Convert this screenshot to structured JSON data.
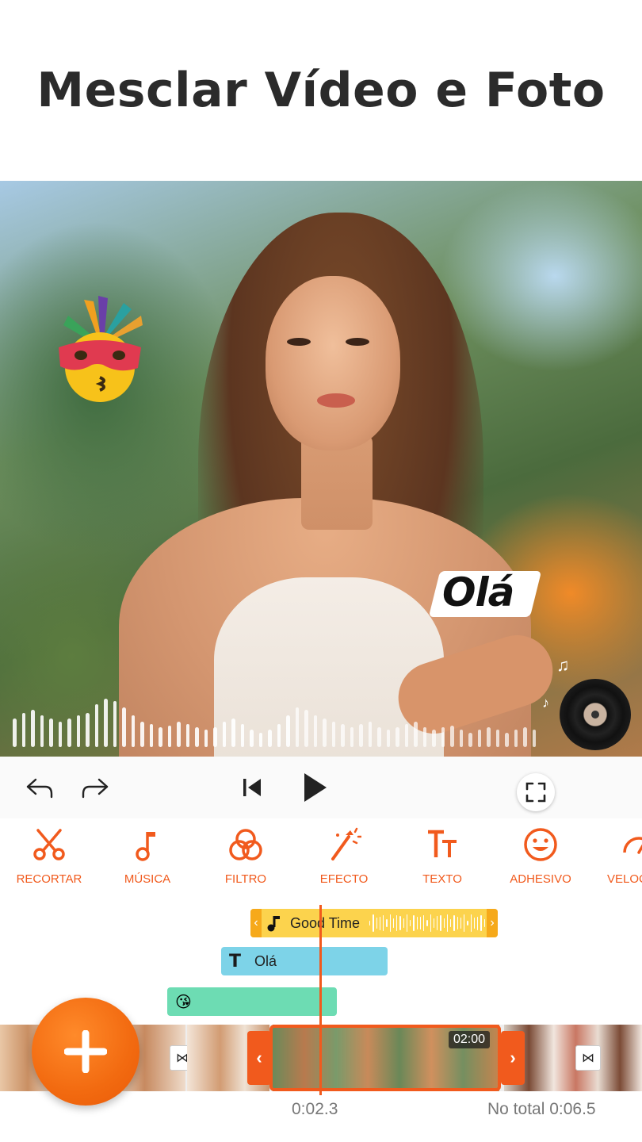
{
  "headline": "Mesclar Vídeo e Foto",
  "preview": {
    "text_sticker": "Olá",
    "waveform_levels": [
      0.5,
      0.6,
      0.65,
      0.55,
      0.5,
      0.45,
      0.5,
      0.55,
      0.6,
      0.75,
      0.85,
      0.8,
      0.7,
      0.55,
      0.45,
      0.4,
      0.35,
      0.38,
      0.45,
      0.4,
      0.35,
      0.3,
      0.35,
      0.45,
      0.5,
      0.4,
      0.3,
      0.25,
      0.3,
      0.4,
      0.55,
      0.7,
      0.65,
      0.55,
      0.5,
      0.45,
      0.4,
      0.35,
      0.4,
      0.45,
      0.35,
      0.3,
      0.35,
      0.4,
      0.45,
      0.35,
      0.3,
      0.35,
      0.38,
      0.3,
      0.25,
      0.3,
      0.35,
      0.3,
      0.25,
      0.3,
      0.35,
      0.3
    ]
  },
  "controls": {
    "undo_icon": "undo-icon",
    "redo_icon": "redo-icon",
    "skip_back_icon": "skip-back-icon",
    "play_icon": "play-icon",
    "fullscreen_icon": "fullscreen-icon"
  },
  "toolbar": {
    "items": [
      {
        "label": "RECORTAR",
        "icon": "scissors-icon"
      },
      {
        "label": "MÚSICA",
        "icon": "music-note-icon"
      },
      {
        "label": "FILTRO",
        "icon": "filter-circles-icon"
      },
      {
        "label": "EFECTO",
        "icon": "magic-wand-icon"
      },
      {
        "label": "TEXTO",
        "icon": "text-tt-icon"
      },
      {
        "label": "ADHESIVO",
        "icon": "smiley-icon"
      },
      {
        "label": "VELOC",
        "icon": "speedometer-icon"
      }
    ]
  },
  "timeline": {
    "music_track": "Good Time",
    "text_track": "Olá",
    "sticker_track_emoji": "😘",
    "selected_clip_duration": "02:00",
    "current_time": "0:02.3",
    "total_time": "No total 0:06.5"
  },
  "fab": {
    "icon": "plus-icon"
  },
  "colors": {
    "accent": "#f15a1d",
    "music_track": "#fcd34d",
    "text_track": "#7dd3e8",
    "sticker_track": "#6ddcb3"
  }
}
